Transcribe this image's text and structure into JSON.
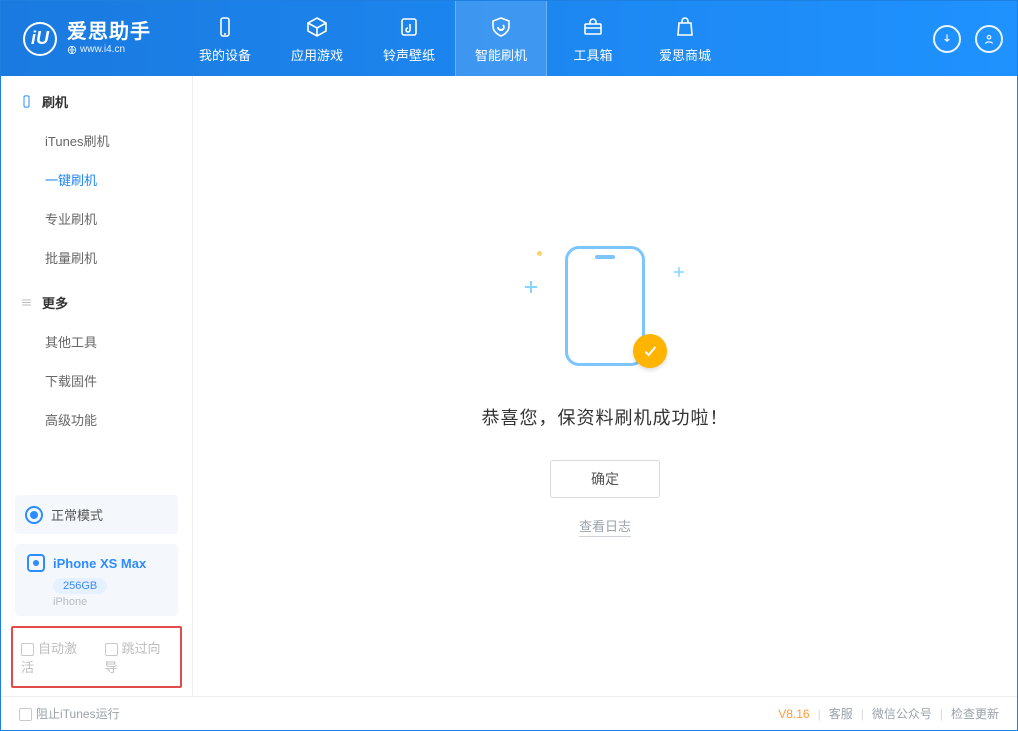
{
  "app": {
    "title": "爱思助手",
    "site": "www.i4.cn"
  },
  "nav": {
    "items": [
      {
        "label": "我的设备"
      },
      {
        "label": "应用游戏"
      },
      {
        "label": "铃声壁纸"
      },
      {
        "label": "智能刷机"
      },
      {
        "label": "工具箱"
      },
      {
        "label": "爱思商城"
      }
    ]
  },
  "sidebar": {
    "group1": "刷机",
    "items1": [
      "iTunes刷机",
      "一键刷机",
      "专业刷机",
      "批量刷机"
    ],
    "group2": "更多",
    "items2": [
      "其他工具",
      "下载固件",
      "高级功能"
    ],
    "mode": "正常模式",
    "device": {
      "name": "iPhone XS Max",
      "storage": "256GB",
      "type": "iPhone"
    },
    "opts": {
      "autoActivate": "自动激活",
      "skipGuide": "跳过向导"
    }
  },
  "main": {
    "success": "恭喜您，保资料刷机成功啦！",
    "ok": "确定",
    "logs": "查看日志"
  },
  "footer": {
    "blockItunes": "阻止iTunes运行",
    "version": "V8.16",
    "service": "客服",
    "wechat": "微信公众号",
    "update": "检查更新"
  }
}
